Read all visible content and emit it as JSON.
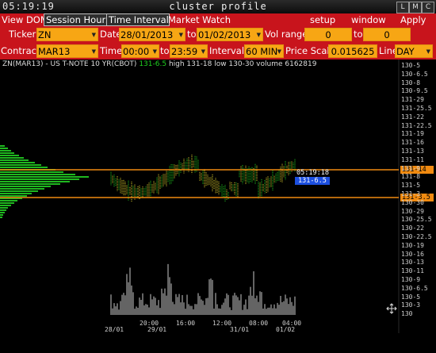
{
  "titlebar": {
    "clock": "05:19:19",
    "title": "cluster profile",
    "btn_l": "L",
    "btn_m": "M",
    "btn_c": "C"
  },
  "menu": {
    "view_dom": "View DOM",
    "session_hours": "Session Hours",
    "time_interval": "Time Interval",
    "market_watch": "Market Watch",
    "setup": "setup",
    "window": "window",
    "apply": "Apply"
  },
  "row1": {
    "ticker_label": "Ticker",
    "ticker_value": "ZN",
    "date_label": "Date",
    "date_from": "28/01/2013",
    "to_label": "to",
    "date_to": "01/02/2013",
    "vol_range_label": "Vol range",
    "vol_from": "0",
    "vol_to_label": "to",
    "vol_to": "0"
  },
  "row2": {
    "contract_label": "Contract",
    "contract_value": "MAR13",
    "time_label": "Time",
    "time_from": "00:00",
    "to_label": "to",
    "time_to": "23:59",
    "interval_label": "Interval",
    "interval_value": "60 MIN",
    "price_scale_label": "Price Scale",
    "price_scale_value": "0.015625",
    "line_label": "Line",
    "line_value": "DAY"
  },
  "info": {
    "desc": "ZN(MAR13) - US T-NOTE 10 YR(CBOT)",
    "last": "131-6.5",
    "high": "high 131-18",
    "low": "low 130-30",
    "volume": "volume 6162819"
  },
  "tags": {
    "time_label": "05:19:18",
    "price_label": "131-6.5",
    "upper_line": "131-14",
    "lower_line": "131-3.5"
  },
  "colors": {
    "menu_red": "#c8141c",
    "field_orange": "#f7a614",
    "candle_green": "#1fd11f",
    "line_orange": "#f08a10",
    "tag_blue": "#1c4fe0"
  },
  "y_ticks": [
    "130-5",
    "130-6.5",
    "130-8",
    "130-9.5",
    "131-29",
    "131-25.5",
    "131-22",
    "131-22.5",
    "131-19",
    "131-16",
    "131-13",
    "131-11",
    "131-9",
    "131-8",
    "131-5",
    "131-3",
    "130-30",
    "130-29",
    "130-25.5",
    "130-22",
    "130-22.5",
    "130-19",
    "130-16",
    "130-13",
    "130-11",
    "130-9",
    "130-6.5",
    "130-5",
    "130-3",
    "130"
  ],
  "x_ticks": [
    "20:00",
    "16:00",
    "12:00",
    "08:00",
    "04:00"
  ],
  "x_dates": [
    "28/01",
    "29/01",
    "31/01",
    "01/02"
  ]
}
